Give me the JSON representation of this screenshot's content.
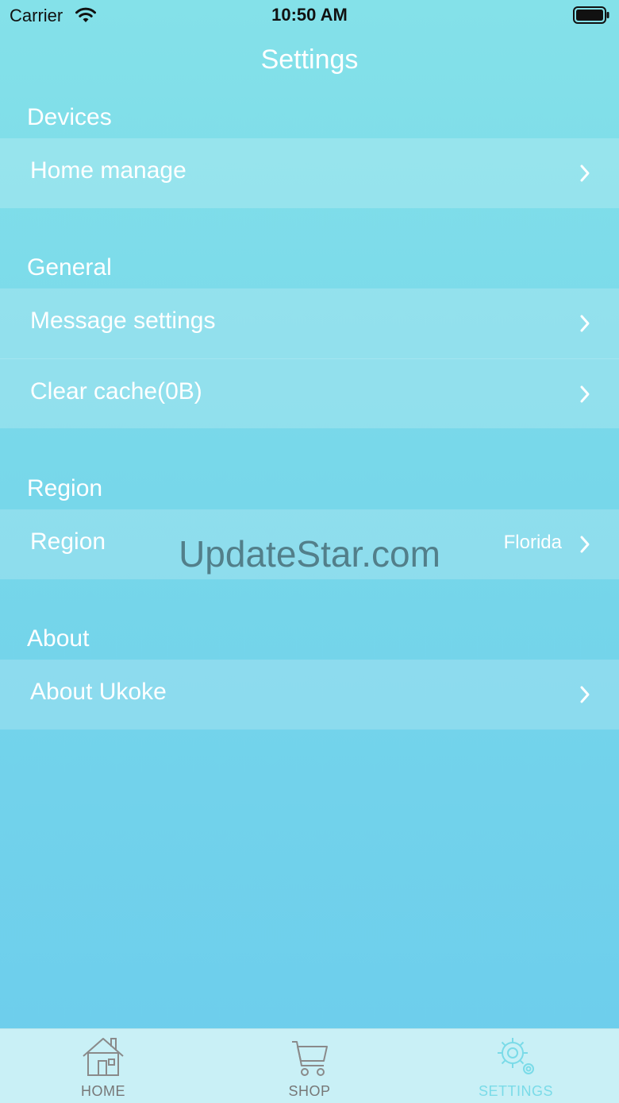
{
  "status_bar": {
    "carrier": "Carrier",
    "time": "10:50 AM",
    "icons": [
      "wifi-icon",
      "battery-icon"
    ]
  },
  "nav": {
    "title": "Settings"
  },
  "sections": {
    "devices": {
      "header": "Devices",
      "items": [
        {
          "label": "Home manage"
        }
      ]
    },
    "general": {
      "header": "General",
      "items": [
        {
          "label": "Message settings"
        },
        {
          "label": "Clear cache(0B)"
        }
      ]
    },
    "region": {
      "header": "Region",
      "items": [
        {
          "label": "Region",
          "value": "Florida"
        }
      ]
    },
    "about": {
      "header": "About",
      "items": [
        {
          "label": "About Ukoke"
        }
      ]
    }
  },
  "watermark": "UpdateStar.com",
  "tab_bar": {
    "tabs": [
      {
        "label": "HOME",
        "icon": "home-icon",
        "active": false
      },
      {
        "label": "SHOP",
        "icon": "cart-icon",
        "active": false
      },
      {
        "label": "SETTINGS",
        "icon": "gear-icon",
        "active": true
      }
    ]
  },
  "colors": {
    "background_top": "#84e1e9",
    "background_bottom": "#6ccdec",
    "tab_bar": "#c9f0f6",
    "tab_active": "#7adbe8",
    "tab_inactive": "#777777"
  }
}
